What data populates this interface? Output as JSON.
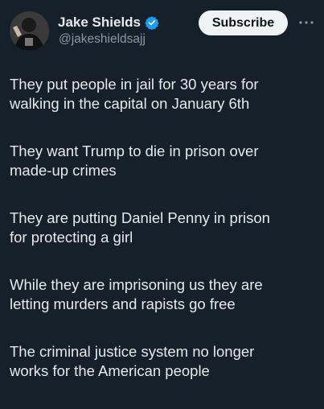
{
  "author": {
    "display_name": "Jake Shields",
    "handle": "@jakeshieldsajj",
    "verified": true,
    "avatar": "profile-photo"
  },
  "actions": {
    "subscribe_label": "Subscribe",
    "more_icon": "more-horizontal-icon"
  },
  "tweet": {
    "paragraphs": [
      "They put people in jail for 30 years for\nwalking in the capital on January 6th",
      "They want Trump to die in prison over\nmade-up crimes",
      "They are putting Daniel Penny in prison\nfor protecting a girl",
      "While they are imprisoning us they are\nletting murders and rapists go free",
      "The criminal justice system no longer\nworks for the American people"
    ]
  },
  "colors": {
    "background": "#15202b",
    "text": "#e7e9ea",
    "secondary_text": "#8b98a5",
    "verified_badge": "#1d9bf0",
    "subscribe_bg": "#eff3f4"
  }
}
